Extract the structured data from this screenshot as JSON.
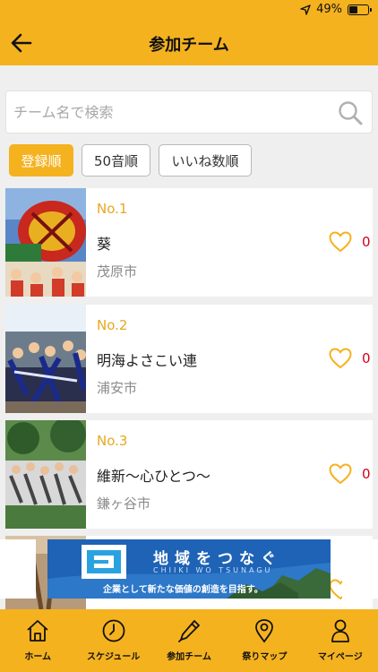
{
  "status_bar": {
    "battery_text": "49%",
    "battery_level": 0.49
  },
  "header": {
    "title": "参加チーム"
  },
  "search": {
    "placeholder": "チーム名で検索",
    "value": ""
  },
  "sort": {
    "options": [
      {
        "label": "登録順",
        "active": true
      },
      {
        "label": "50音順",
        "active": false
      },
      {
        "label": "いいね数順",
        "active": false
      }
    ]
  },
  "teams": [
    {
      "no": "No.1",
      "name": "葵",
      "city": "茂原市",
      "likes": "0"
    },
    {
      "no": "No.2",
      "name": "明海よさこい連",
      "city": "浦安市",
      "likes": "0"
    },
    {
      "no": "No.3",
      "name": "維新〜心ひとつ〜",
      "city": "鎌ヶ谷市",
      "likes": "0"
    }
  ],
  "ad": {
    "title": "地域をつなぐ",
    "subtitle": "CHIIKI WO TSUNAGU",
    "tagline": "企業として新たな価値の創造を目指す。"
  },
  "tabbar": {
    "items": [
      {
        "label": "ホーム",
        "icon": "home-icon"
      },
      {
        "label": "スケジュール",
        "icon": "clock-icon"
      },
      {
        "label": "参加チーム",
        "icon": "pen-icon"
      },
      {
        "label": "祭りマップ",
        "icon": "map-pin-icon"
      },
      {
        "label": "マイページ",
        "icon": "person-icon"
      }
    ]
  },
  "colors": {
    "accent": "#f5b21f",
    "like": "#d0021b",
    "number": "#e6a820"
  }
}
